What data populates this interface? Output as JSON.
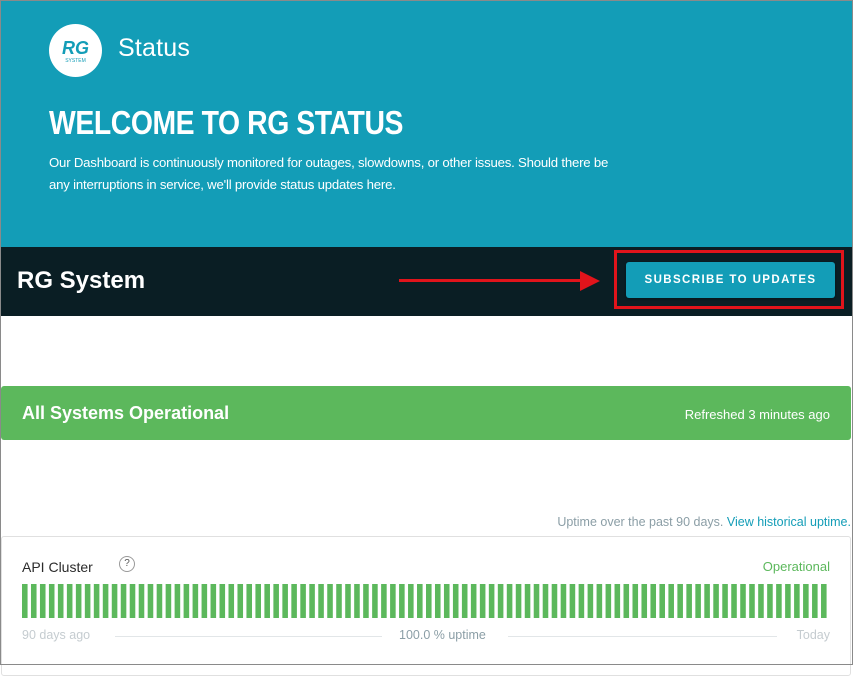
{
  "hero": {
    "logo_text": "RG",
    "logo_subtext": "SYSTEM",
    "brand_label": "Status",
    "title": "WELCOME TO RG STATUS",
    "description": "Our Dashboard is continuously monitored for outages, slowdowns, or other issues. Should there be any interruptions in service, we'll provide status updates here."
  },
  "header": {
    "title": "RG System",
    "subscribe_label": "SUBSCRIBE TO UPDATES"
  },
  "status": {
    "message": "All Systems Operational",
    "refreshed": "Refreshed 3 minutes ago"
  },
  "uptime": {
    "note": "Uptime over the past 90 days.",
    "link": "View historical uptime."
  },
  "component": {
    "name": "API Cluster",
    "help": "?",
    "status": "Operational",
    "days": 90,
    "bar_color": "#5cb85c",
    "legend_left": "90 days ago",
    "legend_center": "100.0 % uptime",
    "legend_right": "Today"
  },
  "colors": {
    "brand": "#139db7",
    "header_bg": "#0a1e24",
    "success": "#5cb85c",
    "annotation": "#e0141b"
  }
}
